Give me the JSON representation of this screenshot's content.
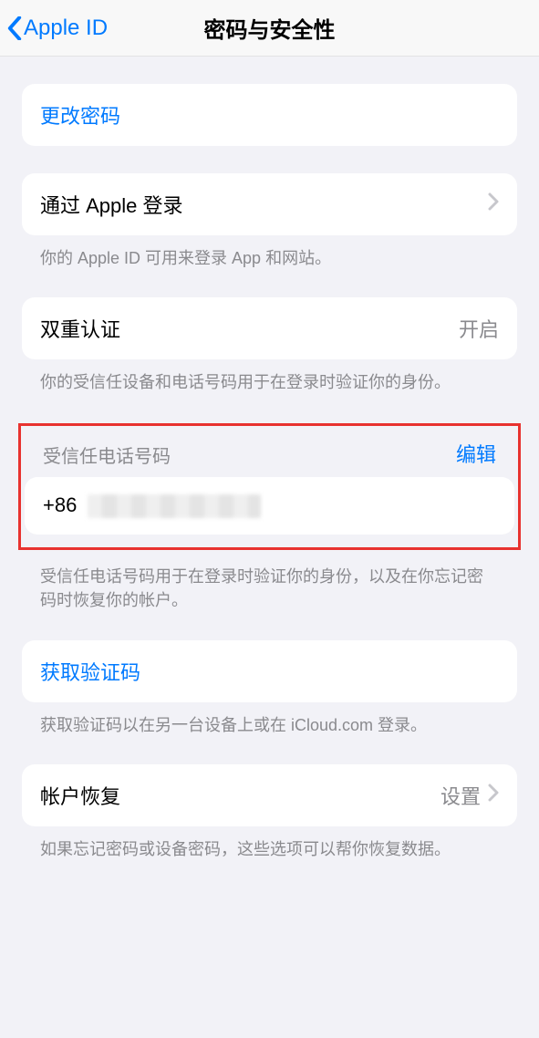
{
  "header": {
    "back_label": "Apple ID",
    "title": "密码与安全性"
  },
  "change_password": {
    "label": "更改密码"
  },
  "sign_in_with_apple": {
    "label": "通过 Apple 登录",
    "footer": "你的 Apple ID 可用来登录 App 和网站。"
  },
  "two_factor": {
    "label": "双重认证",
    "value": "开启",
    "footer": "你的受信任设备和电话号码用于在登录时验证你的身份。"
  },
  "trusted_phone": {
    "header": "受信任电话号码",
    "edit": "编辑",
    "prefix": "+86",
    "number_redacted": true,
    "footer": "受信任电话号码用于在登录时验证你的身份，以及在你忘记密码时恢复你的帐户。"
  },
  "get_code": {
    "label": "获取验证码",
    "footer": "获取验证码以在另一台设备上或在 iCloud.com 登录。"
  },
  "account_recovery": {
    "label": "帐户恢复",
    "value": "设置",
    "footer": "如果忘记密码或设备密码，这些选项可以帮你恢复数据。"
  }
}
